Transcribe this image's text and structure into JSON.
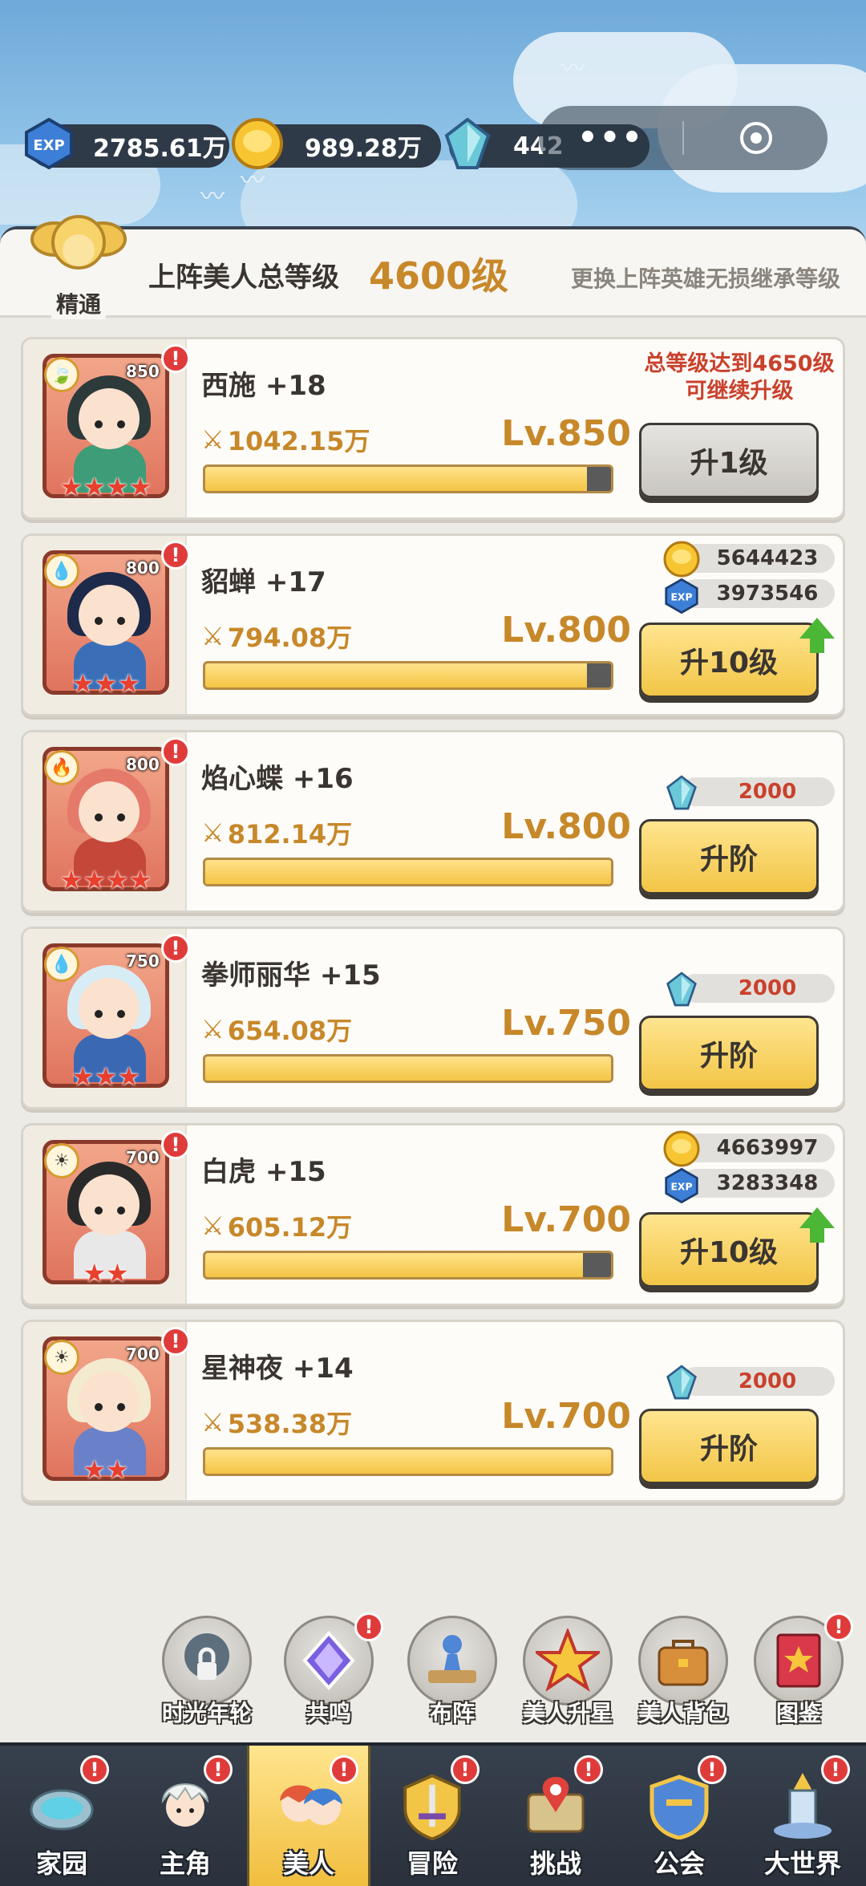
{
  "resources": {
    "exp": {
      "value": "2785.61万",
      "icon": "exp-icon"
    },
    "gold": {
      "value": "989.28万",
      "icon": "gold-coin-icon"
    },
    "gem": {
      "value": "442",
      "icon": "crystal-icon"
    }
  },
  "capsule": {
    "more": "•••",
    "close": "◉"
  },
  "header": {
    "mastery_label": "精通",
    "total_label": "上阵美人总等级",
    "total_value": "4600级",
    "hint": "更换上阵英雄无损继承等级"
  },
  "heroes": [
    {
      "name": "西施 +18",
      "power": "1042.15万",
      "level": "Lv.850",
      "badge": "850",
      "stars": "★★★★",
      "progress": 0.94,
      "button": "升1级",
      "requirement": "总等级达到4650级\n可继续升级"
    },
    {
      "name": "貂蝉 +17",
      "power": "794.08万",
      "level": "Lv.800",
      "badge": "800",
      "stars": "★★★",
      "progress": 0.94,
      "button": "升10级",
      "cost_gold": "5644423",
      "cost_exp": "3973546"
    },
    {
      "name": "焰心蝶 +16",
      "power": "812.14万",
      "level": "Lv.800",
      "badge": "800",
      "stars": "★★★★",
      "progress": 1.0,
      "button": "升阶",
      "cost_crystal": "2000"
    },
    {
      "name": "拳师丽华 +15",
      "power": "654.08万",
      "level": "Lv.750",
      "badge": "750",
      "stars": "★★★",
      "progress": 1.0,
      "button": "升阶",
      "cost_crystal": "2000"
    },
    {
      "name": "白虎 +15",
      "power": "605.12万",
      "level": "Lv.700",
      "badge": "700",
      "stars": "★★",
      "progress": 0.93,
      "button": "升10级",
      "cost_gold": "4663997",
      "cost_exp": "3283348"
    },
    {
      "name": "星神夜 +14",
      "power": "538.38万",
      "level": "Lv.700",
      "badge": "700",
      "stars": "★★",
      "progress": 1.0,
      "button": "升阶",
      "cost_crystal": "2000"
    }
  ],
  "functions": [
    {
      "label": "时光年轮",
      "icon": "tree-lock-icon"
    },
    {
      "label": "共鸣",
      "icon": "resonance-crystal-icon"
    },
    {
      "label": "布阵",
      "icon": "formation-pawn-icon"
    },
    {
      "label": "美人升星",
      "icon": "star-up-icon"
    },
    {
      "label": "美人背包",
      "icon": "backpack-icon"
    },
    {
      "label": "图鉴",
      "icon": "book-icon"
    }
  ],
  "nav": [
    {
      "label": "家园",
      "icon": "home-pool-icon"
    },
    {
      "label": "主角",
      "icon": "hero-portrait-icon"
    },
    {
      "label": "美人",
      "icon": "beauty-duo-icon"
    },
    {
      "label": "冒险",
      "icon": "sword-shield-icon"
    },
    {
      "label": "挑战",
      "icon": "map-pin-icon"
    },
    {
      "label": "公会",
      "icon": "guild-shield-icon"
    },
    {
      "label": "大世界",
      "icon": "world-tower-icon"
    }
  ],
  "alert_mark": "!",
  "colors": {
    "accent_gold": "#c7882a",
    "alert_red": "#e03b3b",
    "button_gold": "#f2c546",
    "nav_bg": "#2f3743"
  }
}
